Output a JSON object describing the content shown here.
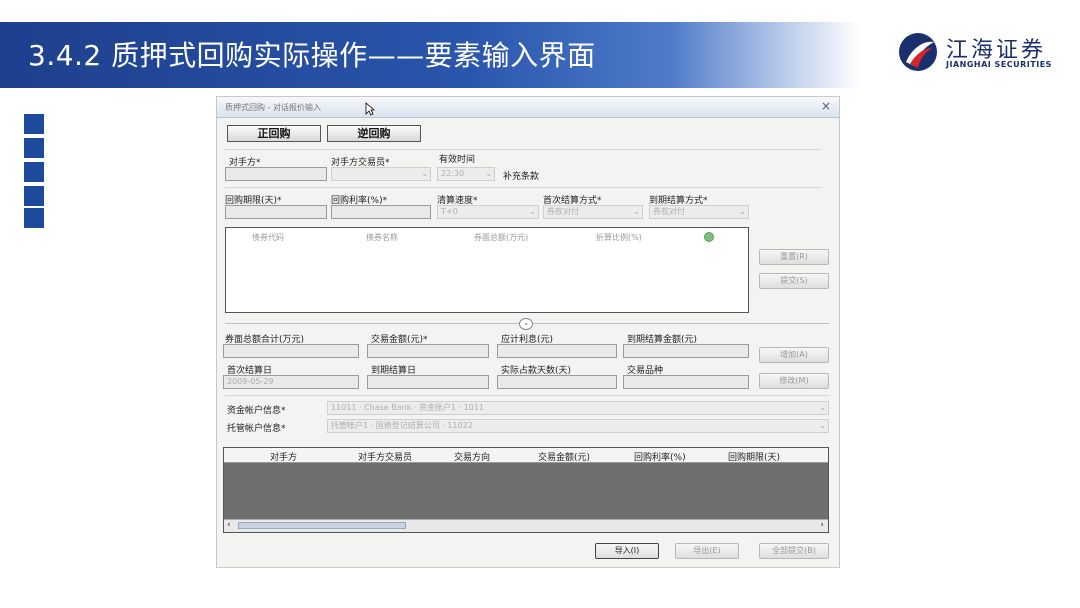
{
  "slide": {
    "title": "3.4.2 质押式回购实际操作——要素输入界面",
    "logo": {
      "cn": "江海证券",
      "en": "JIANGHAI SECURITIES",
      "icon": "jianghai-logo-icon"
    },
    "colors": {
      "header": "#1e3f8c",
      "accent": "#1e4a9c"
    }
  },
  "window": {
    "title": "质押式回购 - 对话报价输入",
    "close_label": "×",
    "tabs": {
      "forward": "正回购",
      "reverse": "逆回购"
    },
    "fields": {
      "counterparty": "对手方*",
      "trader": "对手方交易员*",
      "valid_time": "有效时间",
      "valid_time_value": "22:30",
      "supplement": "补充条款",
      "repo_term": "回购期限(天)*",
      "repo_rate": "回购利率(%)*",
      "clearing_speed": "清算速度*",
      "clearing_speed_value": "T+0",
      "first_settle": "首次结算方式*",
      "first_settle_value": "券款对付",
      "maturity_settle": "到期结算方式*",
      "maturity_settle_value": "券款对付",
      "face_total": "券面总额合计(万元)",
      "trade_amount": "交易金额(元)*",
      "accrued_interest": "应计利息(元)",
      "maturity_amount": "到期结算金额(元)",
      "first_settle_date": "首次结算日",
      "first_settle_date_value": "2009-05-29",
      "maturity_date": "到期结算日",
      "actual_days": "实际占款天数(天)",
      "product": "交易品种",
      "fund_account": "资金帐户信息*",
      "fund_account_value": "11011 · Chase Bank · 资金账户1 · 1011",
      "custody_account": "托管帐户信息*",
      "custody_account_value": "托管帐户1 · 国债登记结算公司 · 11022"
    },
    "bond_table": {
      "headers": [
        "债券代码",
        "债券名称",
        "券面总额(万元)",
        "折算比例(%)"
      ]
    },
    "side_buttons": {
      "reset": "重置(R)",
      "submit": "提交(S)",
      "add": "增加(A)",
      "modify": "修改(M)"
    },
    "quote_table": {
      "headers": [
        "对手方",
        "对手方交易员",
        "交易方向",
        "交易金额(元)",
        "回购利率(%)",
        "回购期限(天)"
      ]
    },
    "bottom_buttons": {
      "import": "导入(I)",
      "export": "导出(E)",
      "submit_all": "全部提交(B)"
    }
  }
}
